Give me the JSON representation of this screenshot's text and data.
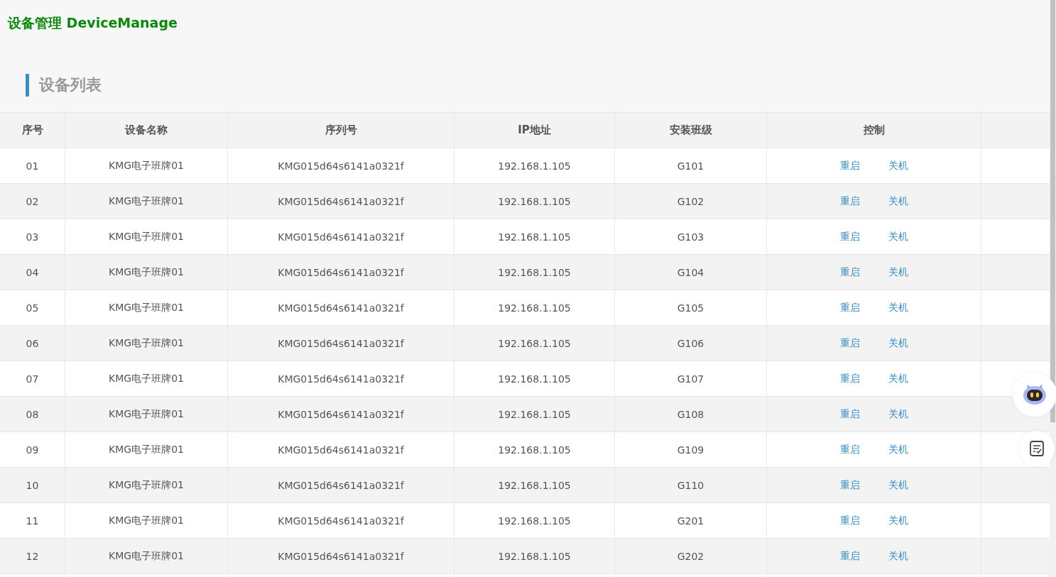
{
  "app_title": "设备管理 DeviceManage",
  "section_title": "设备列表",
  "table": {
    "columns": [
      "序号",
      "设备名称",
      "序列号",
      "IP地址",
      "安装班级",
      "控制"
    ],
    "rows": [
      {
        "index": "01",
        "name": "KMG电子班牌01",
        "serial": "KMG015d64s6141a0321f",
        "ip": "192.168.1.105",
        "class": "G101",
        "actions": [
          "重启",
          "关机"
        ]
      },
      {
        "index": "02",
        "name": "KMG电子班牌01",
        "serial": "KMG015d64s6141a0321f",
        "ip": "192.168.1.105",
        "class": "G102",
        "actions": [
          "重启",
          "关机"
        ]
      },
      {
        "index": "03",
        "name": "KMG电子班牌01",
        "serial": "KMG015d64s6141a0321f",
        "ip": "192.168.1.105",
        "class": "G103",
        "actions": [
          "重启",
          "关机"
        ]
      },
      {
        "index": "04",
        "name": "KMG电子班牌01",
        "serial": "KMG015d64s6141a0321f",
        "ip": "192.168.1.105",
        "class": "G104",
        "actions": [
          "重启",
          "关机"
        ]
      },
      {
        "index": "05",
        "name": "KMG电子班牌01",
        "serial": "KMG015d64s6141a0321f",
        "ip": "192.168.1.105",
        "class": "G105",
        "actions": [
          "重启",
          "关机"
        ]
      },
      {
        "index": "06",
        "name": "KMG电子班牌01",
        "serial": "KMG015d64s6141a0321f",
        "ip": "192.168.1.105",
        "class": "G106",
        "actions": [
          "重启",
          "关机"
        ]
      },
      {
        "index": "07",
        "name": "KMG电子班牌01",
        "serial": "KMG015d64s6141a0321f",
        "ip": "192.168.1.105",
        "class": "G107",
        "actions": [
          "重启",
          "关机"
        ]
      },
      {
        "index": "08",
        "name": "KMG电子班牌01",
        "serial": "KMG015d64s6141a0321f",
        "ip": "192.168.1.105",
        "class": "G108",
        "actions": [
          "重启",
          "关机"
        ]
      },
      {
        "index": "09",
        "name": "KMG电子班牌01",
        "serial": "KMG015d64s6141a0321f",
        "ip": "192.168.1.105",
        "class": "G109",
        "actions": [
          "重启",
          "关机"
        ]
      },
      {
        "index": "10",
        "name": "KMG电子班牌01",
        "serial": "KMG015d64s6141a0321f",
        "ip": "192.168.1.105",
        "class": "G110",
        "actions": [
          "重启",
          "关机"
        ]
      },
      {
        "index": "11",
        "name": "KMG电子班牌01",
        "serial": "KMG015d64s6141a0321f",
        "ip": "192.168.1.105",
        "class": "G201",
        "actions": [
          "重启",
          "关机"
        ]
      },
      {
        "index": "12",
        "name": "KMG电子班牌01",
        "serial": "KMG015d64s6141a0321f",
        "ip": "192.168.1.105",
        "class": "G202",
        "actions": [
          "重启",
          "关机"
        ]
      }
    ]
  }
}
